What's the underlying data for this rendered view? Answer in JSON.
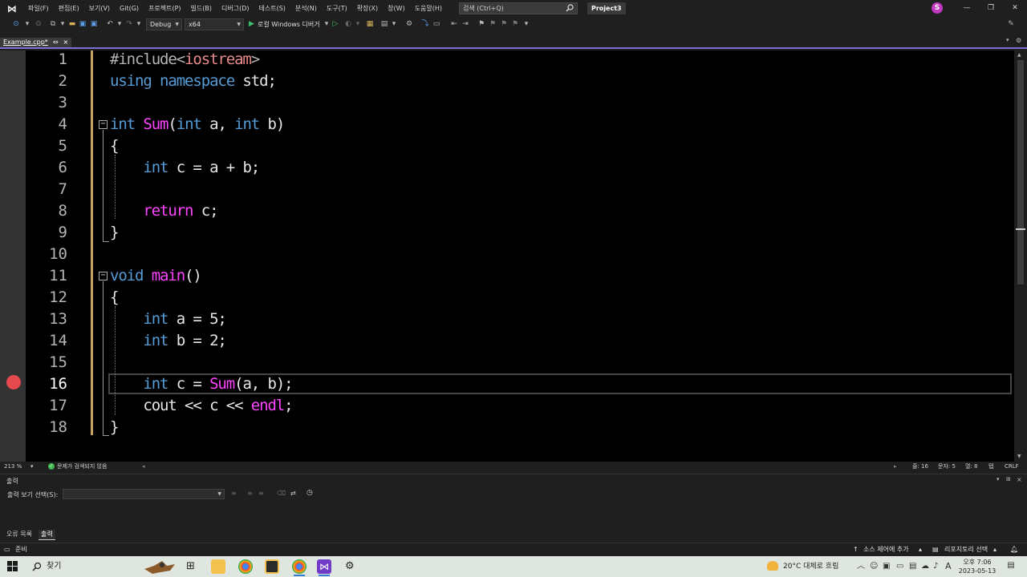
{
  "menu": [
    "파일(F)",
    "편집(E)",
    "보기(V)",
    "Git(G)",
    "프로젝트(P)",
    "빌드(B)",
    "디버그(D)",
    "테스트(S)",
    "분석(N)",
    "도구(T)",
    "확장(X)",
    "창(W)",
    "도움말(H)"
  ],
  "search": {
    "placeholder": "검색 (Ctrl+Q)"
  },
  "project_title": "Project3",
  "account_initial": "S",
  "toolbar": {
    "config": "Debug",
    "platform": "x64",
    "run_label": "로컬 Windows 디버거"
  },
  "tab": {
    "label": "Example.cpp*",
    "pin": "⇔",
    "close": "×"
  },
  "editor": {
    "line_numbers": [
      "1",
      "2",
      "3",
      "4",
      "5",
      "6",
      "7",
      "8",
      "9",
      "10",
      "11",
      "12",
      "13",
      "14",
      "15",
      "16",
      "17",
      "18"
    ],
    "current_line": "16",
    "breakpoint_line": "16",
    "code": [
      "#include<iostream>",
      "using namespace std;",
      "",
      "int Sum(int a, int b)",
      "{",
      "    int c = a + b;",
      "",
      "    return c;",
      "}",
      "",
      "void main()",
      "{",
      "    int a = 5;",
      "    int b = 2;",
      "",
      "    int c = Sum(a, b);",
      "    cout << c << endl;",
      "}"
    ]
  },
  "editor_status": {
    "zoom": "213 %",
    "issues": "문제가 검색되지 않음",
    "line": "줄: 16",
    "col": "문자: 5",
    "pos": "열: 8",
    "indent": "탭",
    "eol": "CRLF"
  },
  "output": {
    "title": "출력",
    "source_label": "출력 보기 선택(S):",
    "source_value": ""
  },
  "bottom_tabs": [
    "오류 목록",
    "출력"
  ],
  "statusbar": {
    "ready": "준비",
    "source_control": "소스 제어에 추가",
    "repo": "리포지토리 선택"
  },
  "taskbar": {
    "search": "찾기",
    "weather": "20°C  대체로 흐림",
    "time": "오후 7:06",
    "date": "2023-05-13",
    "ime": "A"
  }
}
